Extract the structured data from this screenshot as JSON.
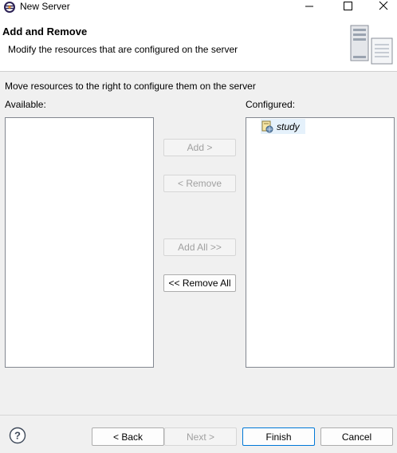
{
  "window": {
    "title": "New Server",
    "icons": {
      "app": "eclipse-icon",
      "minimize": "minimize-icon",
      "maximize": "maximize-icon",
      "close": "close-icon"
    }
  },
  "header": {
    "title": "Add and Remove",
    "description": "Modify the resources that are configured on the server",
    "image": "server-banner-icon"
  },
  "body": {
    "instruction": "Move resources to the right to configure them on the server",
    "available_label": "Available:",
    "configured_label": "Configured:",
    "available_items": [],
    "configured_items": [
      {
        "label": "study",
        "icon": "web-project-icon"
      }
    ]
  },
  "actions": {
    "add": "Add >",
    "remove": "< Remove",
    "add_all": "Add All >>",
    "remove_all": "<< Remove All"
  },
  "footer": {
    "help_icon": "help-icon",
    "back": "< Back",
    "next": "Next >",
    "finish": "Finish",
    "cancel": "Cancel"
  }
}
